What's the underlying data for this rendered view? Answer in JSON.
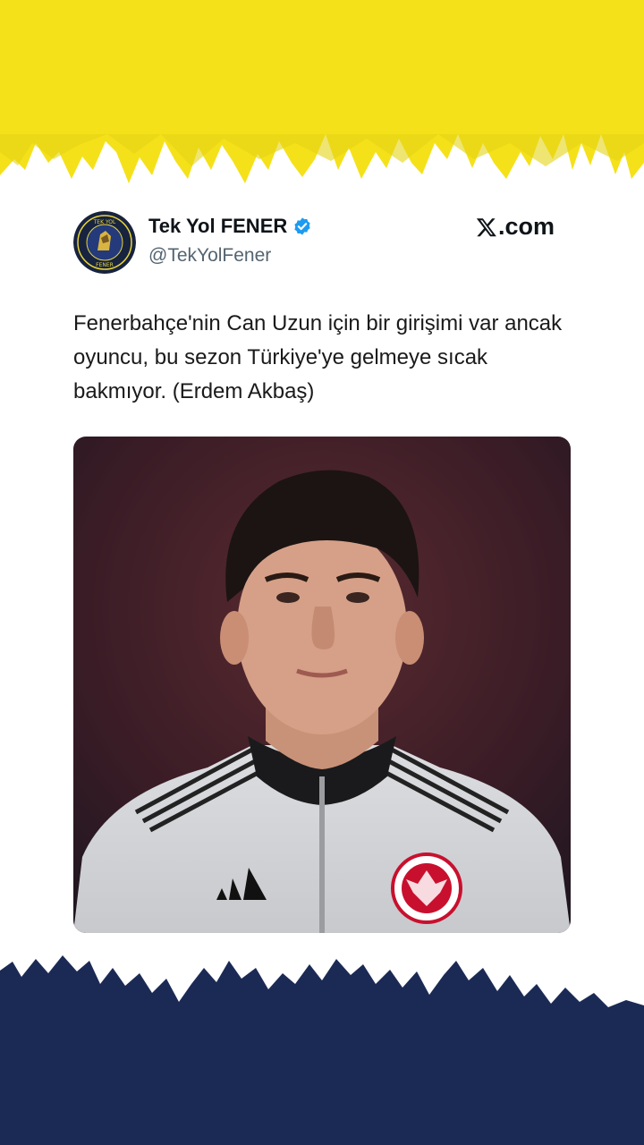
{
  "tweet": {
    "display_name": "Tek Yol FENER",
    "handle": "@TekYolFener",
    "verified_icon": "verified-badge-icon",
    "brand": ".com",
    "brand_icon": "x-logo-icon",
    "text": "Fenerbahçe'nin Can Uzun için bir girişimi var ancak oyuncu, bu sezon Türkiye'ye gelmeye sıcak bakmıyor. (Erdem Akbaş)"
  },
  "avatar": {
    "ring_text": "BABAN YOL YOL TEK YOL FENER"
  },
  "colors": {
    "top_band": "#f5e11a",
    "bottom_band": "#1b2a55",
    "verified": "#1d9bf0",
    "text": "#0f1419",
    "handle": "#536471"
  }
}
